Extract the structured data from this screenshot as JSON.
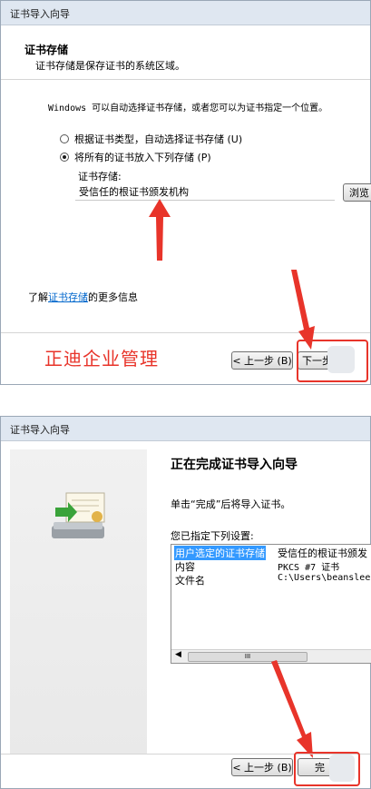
{
  "dialog1": {
    "title": "证书导入向导",
    "section_heading": "证书存储",
    "section_desc": "证书存储是保存证书的系统区域。",
    "intro": "Windows 可以自动选择证书存储，或者您可以为证书指定一个位置。",
    "radio_auto": "根据证书类型，自动选择证书存储 (U)",
    "radio_manual": "将所有的证书放入下列存储 (P)",
    "store_label": "证书存储:",
    "store_value": "受信任的根证书颁发机构",
    "browse_label": "浏览",
    "learn_prefix": "了解",
    "learn_link": "证书存储",
    "learn_suffix": "的更多信息",
    "watermark": "正迪企业管理",
    "back_label": "< 上一步 (B)",
    "next_label": "下一步"
  },
  "dialog2": {
    "title": "证书导入向导",
    "heading": "正在完成证书导入向导",
    "desc": "单击“完成”后将导入证书。",
    "settings_label": "您已指定下列设置:",
    "rows": [
      {
        "key": "用户选定的证书存储",
        "value": "受信任的根证书颁发"
      },
      {
        "key": "内容",
        "value": "PKCS #7 证书"
      },
      {
        "key": "文件名",
        "value": "C:\\Users\\beanslee\\"
      }
    ],
    "scroll_thumb": "III",
    "back_label": "< 上一步 (B)",
    "finish_label": "完"
  },
  "colors": {
    "annotation_red": "#e8342a",
    "watermark_red": "#e8342a",
    "link_blue": "#0066cc",
    "selection_blue": "#3399ff"
  }
}
